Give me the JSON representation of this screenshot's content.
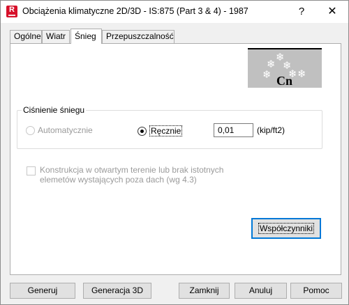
{
  "window": {
    "title": "Obciążenia klimatyczne 2D/3D - IS:875 (Part 3 & 4) - 1987",
    "help_glyph": "?",
    "close_glyph": "✕",
    "app_icon_letter": "R"
  },
  "tabs": [
    {
      "label": "Ogólne",
      "active": false
    },
    {
      "label": "Wiatr",
      "active": false
    },
    {
      "label": "Śnieg",
      "active": true
    },
    {
      "label": "Przepuszczalność",
      "active": false
    }
  ],
  "cn_image": {
    "label": "Cn",
    "snowflake_glyph": "❄",
    "snowflake_count": 6
  },
  "snow_pressure": {
    "group_title": "Ciśnienie śniegu",
    "auto_label": "Automatycznie",
    "auto_enabled": false,
    "manual_label": "Ręcznie",
    "manual_selected": true,
    "value": "0,01",
    "unit": "(kip/ft2)"
  },
  "open_terrain": {
    "label": "Konstrukcja w otwartym terenie lub brak istotnych elemetów wystających poza dach (wg 4.3)",
    "checked": false,
    "enabled": false
  },
  "coefficients_button": "Współczynniki",
  "footer_buttons": {
    "generate": "Generuj",
    "generate_3d": "Generacja 3D",
    "close": "Zamknij",
    "cancel": "Anuluj",
    "help": "Pomoc"
  },
  "colors": {
    "accent": "#0078d7",
    "app_icon": "#d7102a",
    "cn_background": "#c0c0c0"
  }
}
